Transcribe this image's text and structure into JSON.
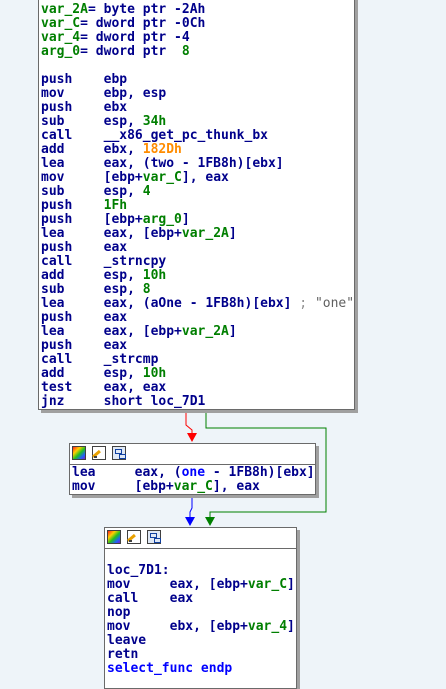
{
  "node1": {
    "lines": [
      [
        [
          "vr",
          "var_2A"
        ],
        [
          "txt",
          "= byte ptr -2Ah"
        ]
      ],
      [
        [
          "vr",
          "var_C"
        ],
        [
          "txt",
          "= dword ptr -0Ch"
        ]
      ],
      [
        [
          "vr",
          "var_4"
        ],
        [
          "txt",
          "= dword ptr -4"
        ]
      ],
      [
        [
          "vr",
          "arg_0"
        ],
        [
          "txt",
          "= dword ptr  "
        ],
        [
          "num",
          "8"
        ]
      ],
      [],
      [
        [
          "ins",
          "push    ebp"
        ]
      ],
      [
        [
          "ins",
          "mov     ebp, esp"
        ]
      ],
      [
        [
          "ins",
          "push    ebx"
        ]
      ],
      [
        [
          "ins",
          "sub     esp, "
        ],
        [
          "num",
          "34h"
        ]
      ],
      [
        [
          "ins",
          "call    __x86_get_pc_thunk_bx"
        ]
      ],
      [
        [
          "ins",
          "add     ebx, "
        ],
        [
          "imm",
          "182Dh"
        ]
      ],
      [
        [
          "ins",
          "lea     eax, (two - 1FB8h)[ebx]"
        ]
      ],
      [
        [
          "ins",
          "mov     [ebp+"
        ],
        [
          "vr",
          "var_C"
        ],
        [
          "ins",
          "], eax"
        ]
      ],
      [
        [
          "ins",
          "sub     esp, "
        ],
        [
          "num",
          "4"
        ]
      ],
      [
        [
          "ins",
          "push    "
        ],
        [
          "num",
          "1Fh"
        ]
      ],
      [
        [
          "ins",
          "push    [ebp+"
        ],
        [
          "vr",
          "arg_0"
        ],
        [
          "ins",
          "]"
        ]
      ],
      [
        [
          "ins",
          "lea     eax, [ebp+"
        ],
        [
          "vr",
          "var_2A"
        ],
        [
          "ins",
          "]"
        ]
      ],
      [
        [
          "ins",
          "push    eax"
        ]
      ],
      [
        [
          "ins",
          "call    _strncpy"
        ]
      ],
      [
        [
          "ins",
          "add     esp, "
        ],
        [
          "num",
          "10h"
        ]
      ],
      [
        [
          "ins",
          "sub     esp, "
        ],
        [
          "num",
          "8"
        ]
      ],
      [
        [
          "ins",
          "lea     eax, (aOne - 1FB8h)[ebx]"
        ],
        [
          "cmt",
          " ; "
        ],
        [
          "str",
          "\"one\""
        ]
      ],
      [
        [
          "ins",
          "push    eax"
        ]
      ],
      [
        [
          "ins",
          "lea     eax, [ebp+"
        ],
        [
          "vr",
          "var_2A"
        ],
        [
          "ins",
          "]"
        ]
      ],
      [
        [
          "ins",
          "push    eax"
        ]
      ],
      [
        [
          "ins",
          "call    _strcmp"
        ]
      ],
      [
        [
          "ins",
          "add     esp, "
        ],
        [
          "num",
          "10h"
        ]
      ],
      [
        [
          "ins",
          "test    eax, eax"
        ]
      ],
      [
        [
          "ins",
          "jnz     short loc_7D1"
        ]
      ]
    ]
  },
  "node2": {
    "lines": [
      [
        [
          "ins",
          "lea     eax, ("
        ],
        [
          "nm",
          "one"
        ],
        [
          "ins",
          " - 1FB8h)[ebx]"
        ]
      ],
      [
        [
          "ins",
          "mov     [ebp+"
        ],
        [
          "vr",
          "var_C"
        ],
        [
          "ins",
          "], eax"
        ]
      ]
    ]
  },
  "node3": {
    "lines": [
      [],
      [
        [
          "lbl",
          "loc_7D1:"
        ]
      ],
      [
        [
          "ins",
          "mov     eax, [ebp+"
        ],
        [
          "vr",
          "var_C"
        ],
        [
          "ins",
          "]"
        ]
      ],
      [
        [
          "ins",
          "call    eax"
        ]
      ],
      [
        [
          "ins",
          "nop"
        ]
      ],
      [
        [
          "ins",
          "mov     ebx, [ebp+"
        ],
        [
          "vr",
          "var_4"
        ],
        [
          "ins",
          "]"
        ]
      ],
      [
        [
          "ins",
          "leave"
        ]
      ],
      [
        [
          "ins",
          "retn"
        ]
      ],
      [
        [
          "nm",
          "select_func endp"
        ]
      ]
    ]
  },
  "colors": {
    "edge_false": "#ff0000",
    "edge_true": "#008000",
    "edge_uncond": "#0000ff"
  }
}
